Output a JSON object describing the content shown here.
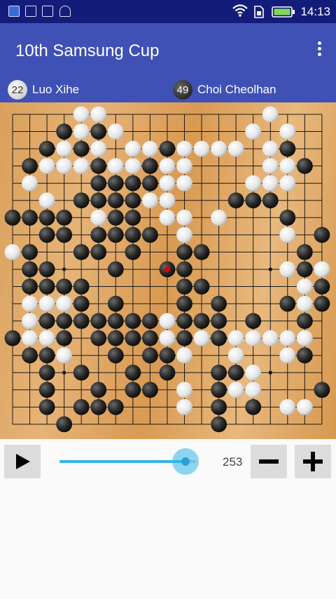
{
  "status_bar": {
    "time": "14:13",
    "icons": [
      "app-icon",
      "warning-image-icon",
      "gallery-icon",
      "android-icon",
      "wifi-icon",
      "sim-icon",
      "battery-icon"
    ]
  },
  "app_bar": {
    "title": "10th Samsung Cup",
    "menu_icon": "more-vert-icon"
  },
  "players": {
    "white": {
      "name": "Luo Xihe",
      "captures": "22"
    },
    "black": {
      "name": "Choi Cheolhan",
      "captures": "49"
    }
  },
  "board": {
    "size": 19,
    "stones": [
      "....WW.........W...",
      "...BWBW.......W.W..",
      "..BWBW.WWBWWWW.WB..",
      ".BWWWBWWBWW....WWB..",
      ".W...BBBBWW...WWW...",
      "..W.BBBBWW...BBB....",
      "BBBB.WBB.WW.W...B...",
      "..BB.BBBB.W.....W.B.",
      "WB..BB.B..BB.....B.",
      ".BB...B..BB.....WBWW",
      ".BBBB.....BB.....WB",
      ".WWWB.B...B.B...BWBW",
      ".WBBBBBBBWBBB.B..B.B",
      "BWWB.BBBBWBWBWWWWW..",
      ".BBW..B.BBW..W..WB..",
      "..B.B..B.B..BBW.....",
      "..B..B.BB.W.BWW...BW",
      "..B.BBB...W.B.B.WW..",
      "...B........B......."
    ],
    "last_move": "K10"
  },
  "controls": {
    "move_number": "253",
    "progress": 1.0,
    "play_icon": "play-icon",
    "minus_icon": "minus-icon",
    "plus_icon": "plus-icon"
  },
  "colors": {
    "status_bar": "#141c7a",
    "app_bar": "#3f51b5",
    "slider_accent": "#33b5e5",
    "last_move_marker": "#e00000"
  }
}
